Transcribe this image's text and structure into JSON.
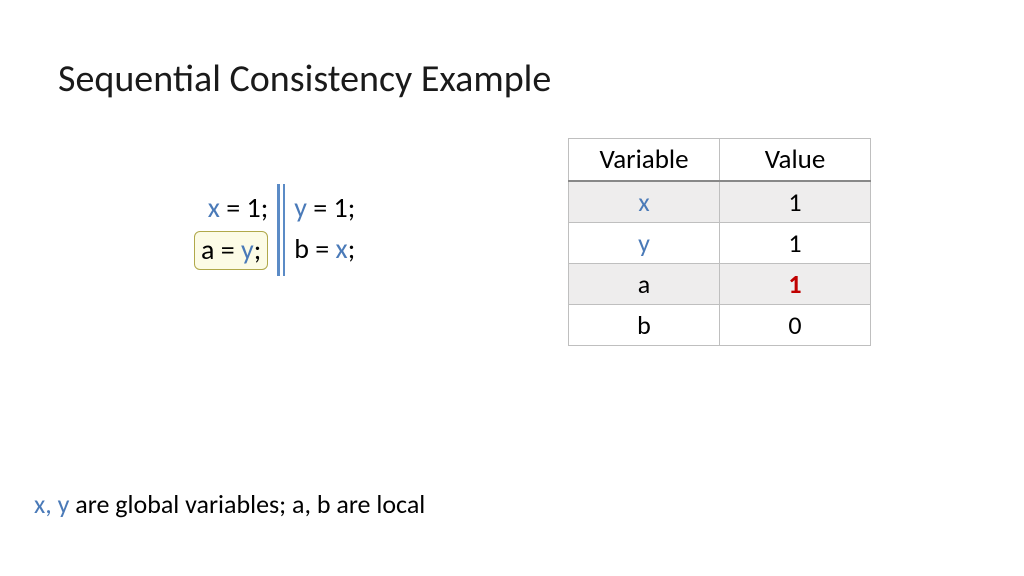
{
  "title": "Sequential Consistency Example",
  "threads": {
    "left": [
      {
        "var": "x",
        "rest": " = 1;",
        "boxed": false
      },
      {
        "var": "a",
        "mid": " = ",
        "rhsVar": "y",
        "tail": ";",
        "boxed": true
      }
    ],
    "right": [
      {
        "var": "y",
        "rest": " = 1;"
      },
      {
        "plain": "b = ",
        "rhsVar": "x",
        "tail": ";"
      }
    ]
  },
  "table": {
    "headers": [
      "Variable",
      "Value"
    ],
    "rows": [
      {
        "name": "x",
        "nameClass": "var-blue",
        "value": "1",
        "valClass": ""
      },
      {
        "name": "y",
        "nameClass": "var-blue",
        "value": "1",
        "valClass": ""
      },
      {
        "name": "a",
        "nameClass": "",
        "value": "1",
        "valClass": "red-bold"
      },
      {
        "name": "b",
        "nameClass": "",
        "value": "0",
        "valClass": ""
      }
    ]
  },
  "footnote": {
    "xy": "x, y",
    "rest": " are global variables; a, b are local"
  }
}
